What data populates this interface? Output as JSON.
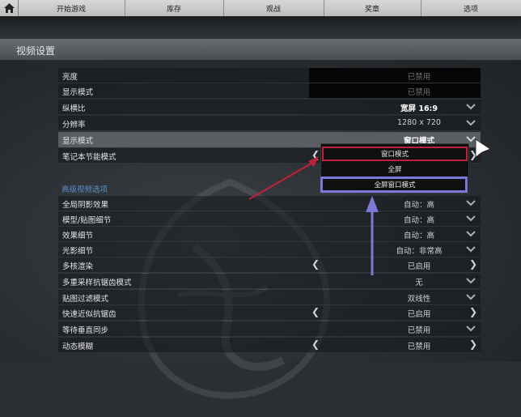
{
  "nav": {
    "tabs": [
      "开始游戏",
      "库存",
      "观战",
      "奖章",
      "选项"
    ]
  },
  "page": {
    "title": "视频设置"
  },
  "settings": [
    {
      "label": "亮度",
      "value": "已禁用"
    },
    {
      "label": "显示模式",
      "value": "已禁用"
    },
    {
      "label": "纵横比",
      "value": "宽屏 16:9"
    },
    {
      "label": "分辨率",
      "value": "1280 x 720"
    },
    {
      "label": "显示模式",
      "value": "窗口模式"
    },
    {
      "label": "笔记本节能模式",
      "value": ""
    }
  ],
  "advanced": {
    "title": "高级视频选项",
    "items": [
      {
        "label": "全局阴影效果",
        "value": "自动：高"
      },
      {
        "label": "模型/贴图细节",
        "value": "自动：高"
      },
      {
        "label": "效果细节",
        "value": "自动：高"
      },
      {
        "label": "光影细节",
        "value": "自动：非常高"
      },
      {
        "label": "多核渲染",
        "value": "已启用"
      },
      {
        "label": "多重采样抗锯齿模式",
        "value": "无"
      },
      {
        "label": "贴图过滤模式",
        "value": "双线性"
      },
      {
        "label": "快速近似抗锯齿",
        "value": "已启用"
      },
      {
        "label": "等待垂直同步",
        "value": "已禁用"
      },
      {
        "label": "动态模糊",
        "value": "已禁用"
      }
    ]
  },
  "dropdown": {
    "options": [
      "窗口模式",
      "全屏",
      "全屏窗口模式"
    ]
  },
  "colors": {
    "annotation_red": "#c41e3a",
    "annotation_blue": "#7b78d8",
    "link_blue": "#5b8ec9"
  }
}
